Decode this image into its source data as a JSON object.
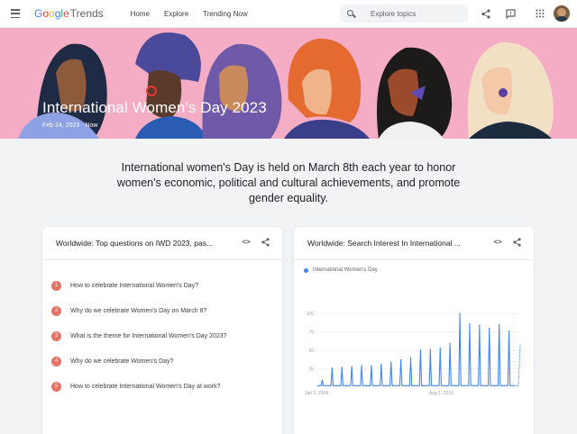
{
  "header": {
    "logo": {
      "g1": "G",
      "g2": "o",
      "g3": "o",
      "g4": "g",
      "g5": "l",
      "g6": "e",
      "trends": "Trends"
    },
    "nav": [
      "Home",
      "Explore",
      "Trending Now"
    ],
    "search_placeholder": "Explore topics",
    "icons": [
      "menu-icon",
      "search-icon",
      "share-icon",
      "feedback-icon",
      "apps-icon",
      "avatar"
    ]
  },
  "banner": {
    "title": "International Women's Day 2023",
    "date_range": "Feb 24, 2023 - Now"
  },
  "description": "International women's Day is held on March 8th each year to honor women's economic, political and cultural achievements, and promote gender equality.",
  "questions_card": {
    "title": "Worldwide: Top questions on IWD 2023, pas...",
    "items": [
      {
        "num": "1",
        "text": "How to celebrate International Women's Day?"
      },
      {
        "num": "2",
        "text": "Why do we celebrate Women's Day on March 8?"
      },
      {
        "num": "3",
        "text": "What is the theme for International Women's Day 2023?"
      },
      {
        "num": "4",
        "text": "Why do we celebrate Women's Day?"
      },
      {
        "num": "5",
        "text": "How to celebrate International Women's Day at work?"
      }
    ]
  },
  "interest_card": {
    "title": "Worldwide: Search Interest In International ...",
    "legend": "International Women's Day"
  },
  "colors": {
    "accent_blue": "#4285f4",
    "question_badge": "#e57368",
    "banner_pink": "#f4adc5"
  },
  "chart_data": {
    "type": "line",
    "series": [
      {
        "name": "International Women's Day",
        "x": [
          "2004",
          "2005",
          "2006",
          "2007",
          "2008",
          "2009",
          "2010",
          "2011",
          "2012",
          "2013",
          "2014",
          "2015",
          "2016",
          "2017",
          "2018",
          "2019",
          "2020",
          "2021",
          "2022",
          "2023"
        ],
        "values": [
          10,
          26,
          27,
          28,
          29,
          29,
          31,
          34,
          37,
          40,
          50,
          51,
          53,
          59,
          100,
          86,
          84,
          80,
          85,
          76
        ]
      }
    ],
    "x_tick_labels": [
      "Jan 1, 2004",
      "Aug 1, 2016"
    ],
    "y_ticks": [
      0,
      25,
      50,
      75,
      100
    ],
    "ylim": [
      0,
      100
    ],
    "baseline": 2,
    "last_point_partial": 58,
    "grid": true
  }
}
